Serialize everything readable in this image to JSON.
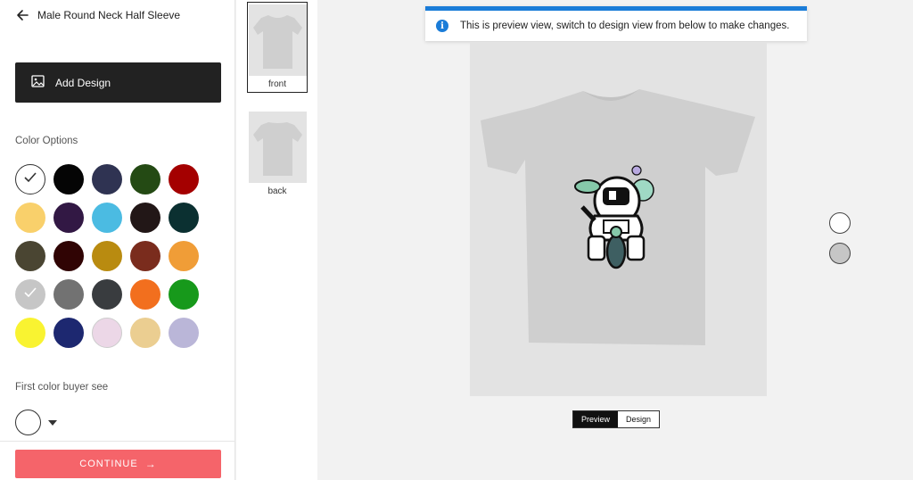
{
  "header": {
    "title": "Male Round Neck Half Sleeve"
  },
  "add_design": {
    "label": "Add Design"
  },
  "color_options": {
    "label": "Color Options",
    "swatches": [
      {
        "color": "#ffffff",
        "selected": true
      },
      {
        "color": "#050505",
        "selected": false
      },
      {
        "color": "#2f3352",
        "selected": false
      },
      {
        "color": "#244a14",
        "selected": false
      },
      {
        "color": "#a40000",
        "selected": false
      },
      {
        "color": "#f9d06b",
        "selected": false
      },
      {
        "color": "#321844",
        "selected": false
      },
      {
        "color": "#4bbbe2",
        "selected": false
      },
      {
        "color": "#221717",
        "selected": false
      },
      {
        "color": "#0b3031",
        "selected": false
      },
      {
        "color": "#4a4532",
        "selected": false
      },
      {
        "color": "#300404",
        "selected": false
      },
      {
        "color": "#b98b10",
        "selected": false
      },
      {
        "color": "#7a2c1d",
        "selected": false
      },
      {
        "color": "#f09d37",
        "selected": false
      },
      {
        "color": "#c6c6c6",
        "selected": true
      },
      {
        "color": "#727272",
        "selected": false
      },
      {
        "color": "#393c3f",
        "selected": false
      },
      {
        "color": "#f26f1e",
        "selected": false
      },
      {
        "color": "#17991b",
        "selected": false
      },
      {
        "color": "#f9f331",
        "selected": false
      },
      {
        "color": "#1d2870",
        "selected": false
      },
      {
        "color": "#ecd7e7",
        "selected": false
      },
      {
        "color": "#ebce91",
        "selected": false
      },
      {
        "color": "#bab6d8",
        "selected": false
      }
    ]
  },
  "first_color": {
    "label": "First color buyer see",
    "value_color": "#ffffff"
  },
  "continue": {
    "label": "CONTINUE"
  },
  "thumbnails": [
    {
      "label": "front",
      "selected": true
    },
    {
      "label": "back",
      "selected": false
    }
  ],
  "notice": {
    "text": "This is preview view, switch to design view from below to make changes."
  },
  "preview_colors": [
    {
      "color": "#ffffff"
    },
    {
      "color": "#c6c6c6"
    }
  ],
  "view_toggle": {
    "preview": "Preview",
    "design": "Design",
    "active": "Preview"
  },
  "theme": {
    "accent": "#f5646a",
    "info": "#1a7cd8",
    "shirt": "#cfcfcf"
  }
}
